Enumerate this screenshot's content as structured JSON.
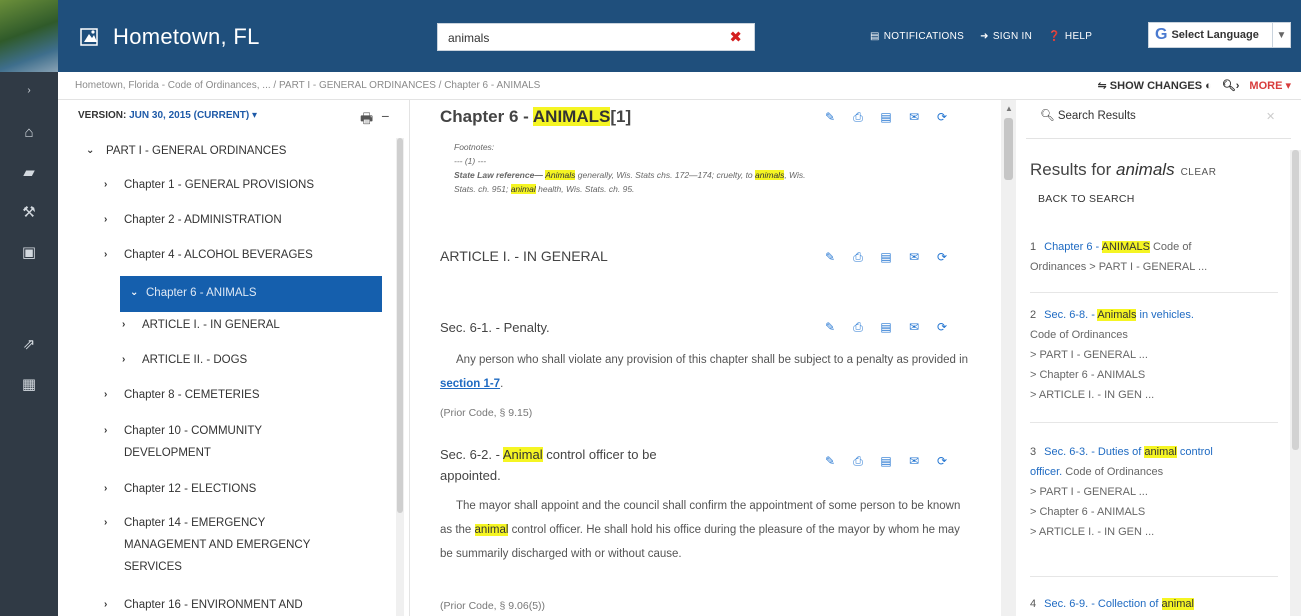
{
  "header": {
    "title": "Hometown, FL",
    "search_value": "animals",
    "notifications": "NOTIFICATIONS",
    "sign_in": "SIGN IN",
    "help": "HELP",
    "language": "Select Language"
  },
  "breadcrumb": {
    "text": "Hometown, Florida - Code of Ordinances, ... / PART I - GENERAL ORDINANCES / Chapter 6 - ANIMALS",
    "show_changes": "SHOW CHANGES",
    "more": "MORE"
  },
  "toc": {
    "version_label": "VERSION:",
    "version_value": "JUN 30, 2015 (CURRENT)",
    "items": [
      {
        "label": "PART I - GENERAL ORDINANCES"
      },
      {
        "label": "Chapter 1 - GENERAL PROVISIONS"
      },
      {
        "label": "Chapter 2 - ADMINISTRATION"
      },
      {
        "label": "Chapter 4 - ALCOHOL BEVERAGES"
      },
      {
        "label": "Chapter 6 - ANIMALS"
      },
      {
        "label": "ARTICLE I. - IN GENERAL"
      },
      {
        "label": "ARTICLE II. - DOGS"
      },
      {
        "label": "Chapter 8 - CEMETERIES"
      },
      {
        "label": "Chapter 10 - COMMUNITY"
      },
      {
        "label": "DEVELOPMENT"
      },
      {
        "label": "Chapter 12 - ELECTIONS"
      },
      {
        "label": "Chapter 14 - EMERGENCY"
      },
      {
        "label": "MANAGEMENT AND EMERGENCY"
      },
      {
        "label": "SERVICES"
      },
      {
        "label": "Chapter 16 - ENVIRONMENT AND"
      }
    ]
  },
  "content": {
    "chapter_prefix": "Chapter 6 - ",
    "chapter_mark": "ANIMALS",
    "chapter_suffix": "[1]",
    "footnotes_label": "Footnotes:",
    "footnote_num": "--- (1) ---",
    "footnote_line1_a": "State Law reference— ",
    "footnote_line1_mark": "Animals",
    "footnote_line1_b": " generally, Wis. Stats chs. 172—174; cruelty, to ",
    "footnote_line1_mark2": "animals",
    "footnote_line1_c": ", Wis.",
    "footnote_line2_a": "Stats. ch. 951; ",
    "footnote_line2_mark": "animal",
    "footnote_line2_b": " health, Wis. Stats. ch. 95.",
    "article_heading": "ARTICLE I. - IN GENERAL",
    "sec1_heading": "Sec. 6-1. - Penalty.",
    "sec1_text_a": "Any person who shall violate any provision of this chapter shall be subject to a penalty as provided in ",
    "sec1_link": "section 1-7",
    "sec1_text_b": ".",
    "sec1_prior": "(Prior Code, § 9.15)",
    "sec2_heading_a": "Sec. 6-2. - ",
    "sec2_heading_mark": "Animal",
    "sec2_heading_b": " control officer to be",
    "sec2_heading_c": "appointed.",
    "sec2_text_a": "The mayor shall appoint and the council shall confirm the appointment of some person to be known as the ",
    "sec2_text_mark": "animal",
    "sec2_text_b": " control officer. He shall hold his office during the pleasure of the mayor by whom he may be summarily discharged with or without cause.",
    "sec2_prior": "(Prior Code, § 9.06(5))"
  },
  "results": {
    "search_label": "Search Results",
    "title_prefix": "Results for ",
    "title_term": "animals",
    "clear": "CLEAR",
    "back": "BACK TO SEARCH",
    "items": [
      {
        "num": "1",
        "title_a": "Chapter 6 - ",
        "title_mark": "ANIMALS",
        "line1_rest": " Code of",
        "line2": "Ordinances > PART I - GENERAL ..."
      },
      {
        "num": "2",
        "title_a": "Sec. 6-8. - ",
        "title_mark": "Animals",
        "title_b": " in vehicles.",
        "line2": "Code of Ordinances",
        "line3": "> PART I - GENERAL ...",
        "line4": "> Chapter 6 - ANIMALS",
        "line5": "> ARTICLE I. - IN GEN ..."
      },
      {
        "num": "3",
        "title_a": "Sec. 6-3. - Duties of ",
        "title_mark": "animal",
        "title_b": " control",
        "line1b": "officer.",
        "line1b_rest": " Code of Ordinances",
        "line2": "> PART I - GENERAL ...",
        "line3": "> Chapter 6 - ANIMALS",
        "line4": "> ARTICLE I. - IN GEN ..."
      },
      {
        "num": "4",
        "title_a": "Sec. 6-9. - Collection of ",
        "title_mark": "animal"
      }
    ]
  },
  "colors": {
    "header_bg": "#1f4f7c",
    "rail_bg": "#303a45",
    "selected_bg": "#155fad",
    "highlight": "#f5f523",
    "link": "#1e6ac2",
    "more": "#d83c3c"
  }
}
